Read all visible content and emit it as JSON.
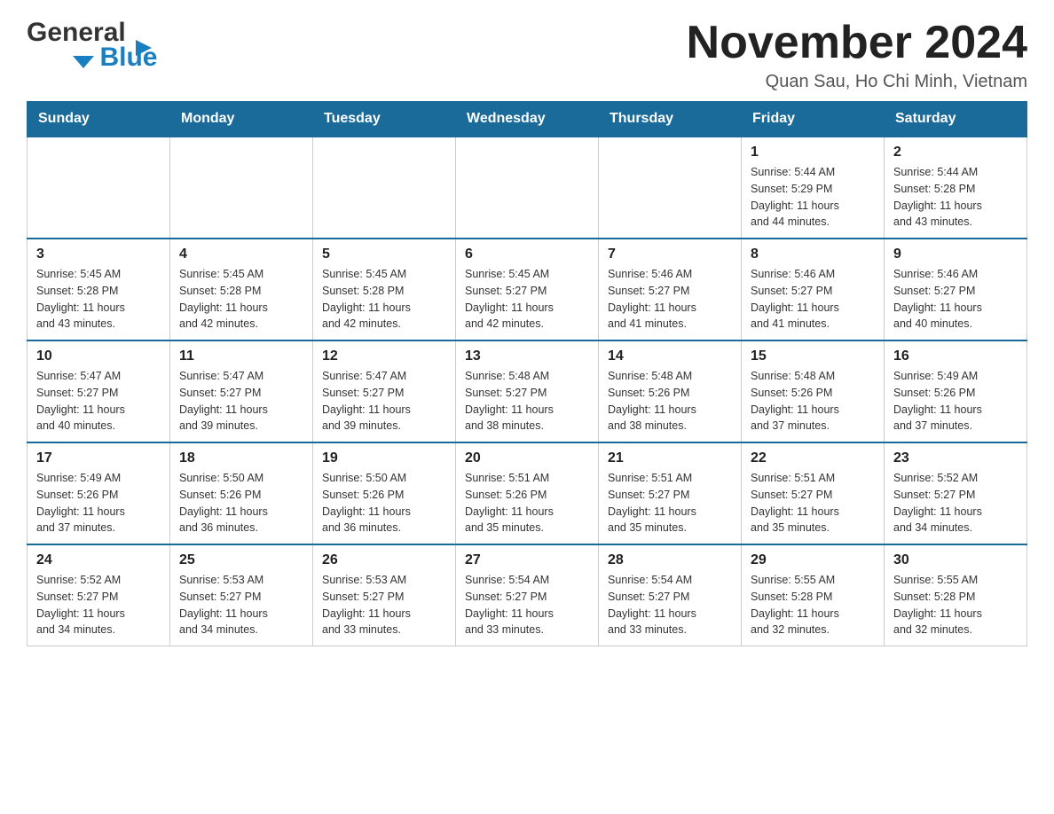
{
  "logo": {
    "general": "General",
    "blue": "Blue"
  },
  "header": {
    "month_title": "November 2024",
    "subtitle": "Quan Sau, Ho Chi Minh, Vietnam"
  },
  "weekdays": [
    "Sunday",
    "Monday",
    "Tuesday",
    "Wednesday",
    "Thursday",
    "Friday",
    "Saturday"
  ],
  "weeks": [
    {
      "days": [
        {
          "number": "",
          "info": ""
        },
        {
          "number": "",
          "info": ""
        },
        {
          "number": "",
          "info": ""
        },
        {
          "number": "",
          "info": ""
        },
        {
          "number": "",
          "info": ""
        },
        {
          "number": "1",
          "info": "Sunrise: 5:44 AM\nSunset: 5:29 PM\nDaylight: 11 hours\nand 44 minutes."
        },
        {
          "number": "2",
          "info": "Sunrise: 5:44 AM\nSunset: 5:28 PM\nDaylight: 11 hours\nand 43 minutes."
        }
      ]
    },
    {
      "days": [
        {
          "number": "3",
          "info": "Sunrise: 5:45 AM\nSunset: 5:28 PM\nDaylight: 11 hours\nand 43 minutes."
        },
        {
          "number": "4",
          "info": "Sunrise: 5:45 AM\nSunset: 5:28 PM\nDaylight: 11 hours\nand 42 minutes."
        },
        {
          "number": "5",
          "info": "Sunrise: 5:45 AM\nSunset: 5:28 PM\nDaylight: 11 hours\nand 42 minutes."
        },
        {
          "number": "6",
          "info": "Sunrise: 5:45 AM\nSunset: 5:27 PM\nDaylight: 11 hours\nand 42 minutes."
        },
        {
          "number": "7",
          "info": "Sunrise: 5:46 AM\nSunset: 5:27 PM\nDaylight: 11 hours\nand 41 minutes."
        },
        {
          "number": "8",
          "info": "Sunrise: 5:46 AM\nSunset: 5:27 PM\nDaylight: 11 hours\nand 41 minutes."
        },
        {
          "number": "9",
          "info": "Sunrise: 5:46 AM\nSunset: 5:27 PM\nDaylight: 11 hours\nand 40 minutes."
        }
      ]
    },
    {
      "days": [
        {
          "number": "10",
          "info": "Sunrise: 5:47 AM\nSunset: 5:27 PM\nDaylight: 11 hours\nand 40 minutes."
        },
        {
          "number": "11",
          "info": "Sunrise: 5:47 AM\nSunset: 5:27 PM\nDaylight: 11 hours\nand 39 minutes."
        },
        {
          "number": "12",
          "info": "Sunrise: 5:47 AM\nSunset: 5:27 PM\nDaylight: 11 hours\nand 39 minutes."
        },
        {
          "number": "13",
          "info": "Sunrise: 5:48 AM\nSunset: 5:27 PM\nDaylight: 11 hours\nand 38 minutes."
        },
        {
          "number": "14",
          "info": "Sunrise: 5:48 AM\nSunset: 5:26 PM\nDaylight: 11 hours\nand 38 minutes."
        },
        {
          "number": "15",
          "info": "Sunrise: 5:48 AM\nSunset: 5:26 PM\nDaylight: 11 hours\nand 37 minutes."
        },
        {
          "number": "16",
          "info": "Sunrise: 5:49 AM\nSunset: 5:26 PM\nDaylight: 11 hours\nand 37 minutes."
        }
      ]
    },
    {
      "days": [
        {
          "number": "17",
          "info": "Sunrise: 5:49 AM\nSunset: 5:26 PM\nDaylight: 11 hours\nand 37 minutes."
        },
        {
          "number": "18",
          "info": "Sunrise: 5:50 AM\nSunset: 5:26 PM\nDaylight: 11 hours\nand 36 minutes."
        },
        {
          "number": "19",
          "info": "Sunrise: 5:50 AM\nSunset: 5:26 PM\nDaylight: 11 hours\nand 36 minutes."
        },
        {
          "number": "20",
          "info": "Sunrise: 5:51 AM\nSunset: 5:26 PM\nDaylight: 11 hours\nand 35 minutes."
        },
        {
          "number": "21",
          "info": "Sunrise: 5:51 AM\nSunset: 5:27 PM\nDaylight: 11 hours\nand 35 minutes."
        },
        {
          "number": "22",
          "info": "Sunrise: 5:51 AM\nSunset: 5:27 PM\nDaylight: 11 hours\nand 35 minutes."
        },
        {
          "number": "23",
          "info": "Sunrise: 5:52 AM\nSunset: 5:27 PM\nDaylight: 11 hours\nand 34 minutes."
        }
      ]
    },
    {
      "days": [
        {
          "number": "24",
          "info": "Sunrise: 5:52 AM\nSunset: 5:27 PM\nDaylight: 11 hours\nand 34 minutes."
        },
        {
          "number": "25",
          "info": "Sunrise: 5:53 AM\nSunset: 5:27 PM\nDaylight: 11 hours\nand 34 minutes."
        },
        {
          "number": "26",
          "info": "Sunrise: 5:53 AM\nSunset: 5:27 PM\nDaylight: 11 hours\nand 33 minutes."
        },
        {
          "number": "27",
          "info": "Sunrise: 5:54 AM\nSunset: 5:27 PM\nDaylight: 11 hours\nand 33 minutes."
        },
        {
          "number": "28",
          "info": "Sunrise: 5:54 AM\nSunset: 5:27 PM\nDaylight: 11 hours\nand 33 minutes."
        },
        {
          "number": "29",
          "info": "Sunrise: 5:55 AM\nSunset: 5:28 PM\nDaylight: 11 hours\nand 32 minutes."
        },
        {
          "number": "30",
          "info": "Sunrise: 5:55 AM\nSunset: 5:28 PM\nDaylight: 11 hours\nand 32 minutes."
        }
      ]
    }
  ]
}
